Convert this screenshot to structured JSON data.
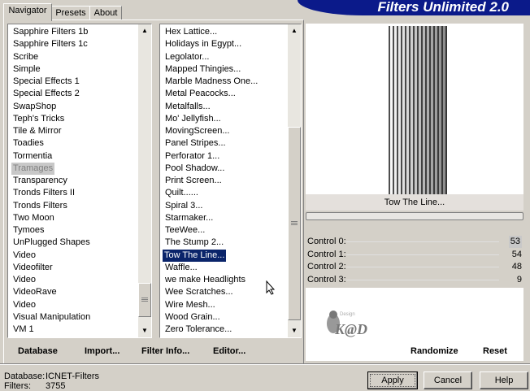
{
  "header": {
    "title": "Filters Unlimited 2.0"
  },
  "tabs": [
    {
      "label": "Navigator"
    },
    {
      "label": "Presets"
    },
    {
      "label": "About"
    }
  ],
  "categories": [
    "Sapphire Filters 1b",
    "Sapphire Filters 1c",
    "Scribe",
    "Simple",
    "Special Effects 1",
    "Special Effects 2",
    "SwapShop",
    "Teph's Tricks",
    "Tile & Mirror",
    "Toadies",
    "Tormentia",
    "Tramages",
    "Transparency",
    "Tronds Filters II",
    "Tronds Filters",
    "Two Moon",
    "Tymoes",
    "UnPlugged Shapes",
    "Video",
    "Videofilter",
    "Video",
    "VideoRave",
    "Video",
    "Visual Manipulation",
    "VM 1"
  ],
  "category_selected": "Tramages",
  "filters": [
    "Hex Lattice...",
    "Holidays in Egypt...",
    "Legolator...",
    "Mapped Thingies...",
    "Marble Madness One...",
    "Metal Peacocks...",
    "Metalfalls...",
    "Mo' Jellyfish...",
    "MovingScreen...",
    "Panel Stripes...",
    "Perforator 1...",
    "Pool Shadow...",
    "Print Screen...",
    "Quilt......",
    "Spiral 3...",
    "Starmaker...",
    "TeeWee...",
    "The Stump 2...",
    "Tow The Line...",
    "Waffle...",
    "we make Headlights",
    "Wee Scratches...",
    "Wire Mesh...",
    "Wood Grain...",
    "Zero Tolerance..."
  ],
  "filter_selected": "Tow The Line...",
  "preview": {
    "filter_name": "Tow The Line..."
  },
  "controls": [
    {
      "label": "Control 0:",
      "value": "53"
    },
    {
      "label": "Control 1:",
      "value": "54"
    },
    {
      "label": "Control 2:",
      "value": "48"
    },
    {
      "label": "Control 3:",
      "value": "9"
    }
  ],
  "toolbar": {
    "database": "Database",
    "import": "Import...",
    "filter_info": "Filter Info...",
    "editor": "Editor...",
    "randomize": "Randomize",
    "reset": "Reset"
  },
  "status": {
    "database_label": "Database:",
    "database_value": "ICNET-Filters",
    "filters_label": "Filters:",
    "filters_value": "3755"
  },
  "buttons": {
    "apply": "Apply",
    "cancel": "Cancel",
    "help": "Help"
  },
  "watermark": "Kad"
}
